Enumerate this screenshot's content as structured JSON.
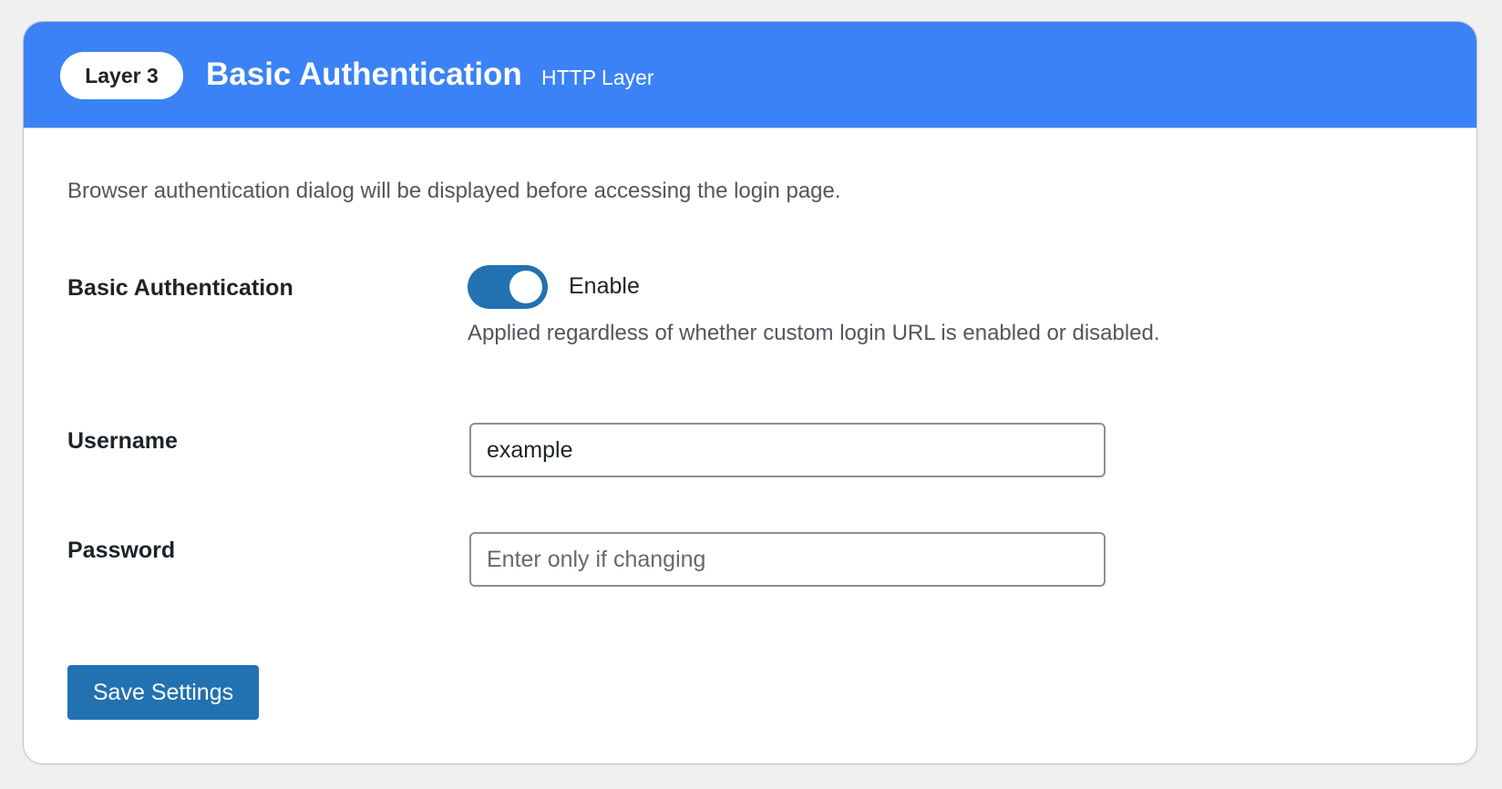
{
  "header": {
    "badge": "Layer 3",
    "title": "Basic Authentication",
    "subtitle": "HTTP Layer",
    "color": "#3b82f6"
  },
  "description": "Browser authentication dialog will be displayed before accessing the login page.",
  "basic_auth": {
    "label": "Basic Authentication",
    "toggle_on": true,
    "toggle_label": "Enable",
    "help": "Applied regardless of whether custom login URL is enabled or disabled."
  },
  "username": {
    "label": "Username",
    "value": "example"
  },
  "password": {
    "label": "Password",
    "placeholder": "Enter only if changing"
  },
  "save_button": {
    "label": "Save Settings",
    "color": "#2271b1"
  }
}
